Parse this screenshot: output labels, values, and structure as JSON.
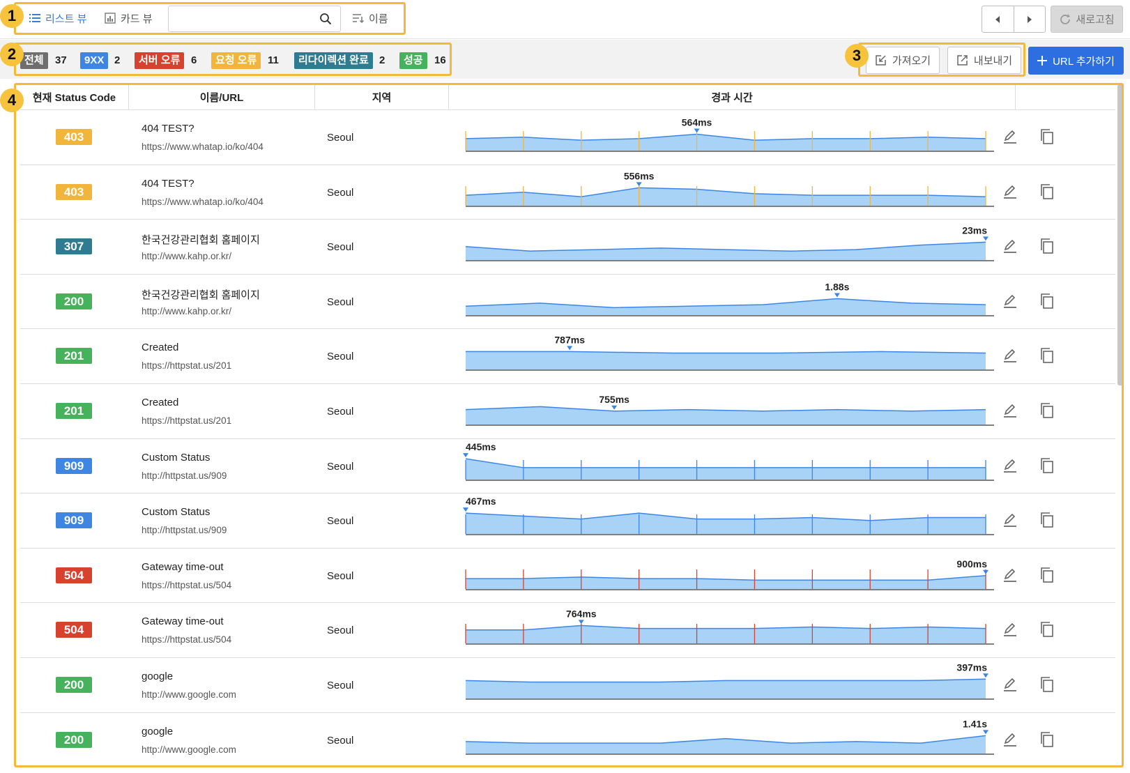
{
  "toolbar": {
    "list_view_label": "리스트 뷰",
    "card_view_label": "카드 뷰",
    "search_value": "",
    "sort_label": "이름",
    "refresh_label": "새로고침"
  },
  "callouts": [
    "1",
    "2",
    "3",
    "4"
  ],
  "filters": [
    {
      "label": "전체",
      "count": "37",
      "color": "#6e6e6e"
    },
    {
      "label": "9XX",
      "count": "2",
      "color": "#3f86e2"
    },
    {
      "label": "서버 오류",
      "count": "6",
      "color": "#d9412f"
    },
    {
      "label": "요청 오류",
      "count": "11",
      "color": "#f1b53b"
    },
    {
      "label": "리다이렉션 완료",
      "count": "2",
      "color": "#2f7c92"
    },
    {
      "label": "성공",
      "count": "16",
      "color": "#46b25b"
    }
  ],
  "actions": {
    "import_label": "가져오기",
    "export_label": "내보내기",
    "add_label": "URL 추가하기"
  },
  "table": {
    "headers": [
      "현재 Status Code",
      "이름/URL",
      "지역",
      "경과 시간",
      ""
    ],
    "rows": [
      {
        "status": "403",
        "status_color": "#f1b53b",
        "name": "404 TEST?",
        "url": "https://www.whatap.io/ko/404",
        "region": "Seoul",
        "peak_label": "564ms",
        "marker_color": "#f1b53b",
        "points": [
          8,
          9,
          7,
          8,
          11,
          7,
          8,
          8,
          9,
          8
        ],
        "peak_index": 4,
        "scale": 13
      },
      {
        "status": "403",
        "status_color": "#f1b53b",
        "name": "404 TEST?",
        "url": "https://www.whatap.io/ko/404",
        "region": "Seoul",
        "peak_label": "556ms",
        "marker_color": "#f1b53b",
        "points": [
          7,
          9,
          6,
          12,
          11,
          8,
          7,
          7,
          7,
          6
        ],
        "peak_index": 3,
        "scale": 13
      },
      {
        "status": "307",
        "status_color": "#2f7c92",
        "name": "한국건강관리협회 홈페이지",
        "url": "http://www.kahp.or.kr/",
        "region": "Seoul",
        "peak_label": "23ms",
        "marker_color": "",
        "points": [
          9,
          6,
          7,
          8,
          7,
          6,
          7,
          10,
          12
        ],
        "peak_index": 8,
        "scale": 13
      },
      {
        "status": "200",
        "status_color": "#46b25b",
        "name": "한국건강관리협회 홈페이지",
        "url": "http://www.kahp.or.kr/",
        "region": "Seoul",
        "peak_label": "1.88s",
        "marker_color": "",
        "points": [
          6,
          8,
          5,
          6,
          7,
          11,
          8,
          7
        ],
        "peak_index": 5,
        "scale": 13
      },
      {
        "status": "201",
        "status_color": "#46b25b",
        "name": "Created",
        "url": "https://httpstat.us/201",
        "region": "Seoul",
        "peak_label": "787ms",
        "marker_color": "",
        "points": [
          12,
          12,
          11,
          11,
          12,
          11
        ],
        "peak_index": 1,
        "scale": 13
      },
      {
        "status": "201",
        "status_color": "#46b25b",
        "name": "Created",
        "url": "https://httpstat.us/201",
        "region": "Seoul",
        "peak_label": "755ms",
        "marker_color": "",
        "points": [
          10,
          12,
          9,
          10,
          9,
          10,
          9,
          10
        ],
        "peak_index": 2,
        "scale": 13
      },
      {
        "status": "909",
        "status_color": "#3f86e2",
        "name": "Custom Status",
        "url": "http://httpstat.us/909",
        "region": "Seoul",
        "peak_label": "445ms",
        "marker_color": "#3f86e2",
        "points": [
          14,
          8,
          8,
          8,
          8,
          8,
          8,
          8,
          8,
          8
        ],
        "peak_index": 0,
        "scale": 15
      },
      {
        "status": "909",
        "status_color": "#3f86e2",
        "name": "Custom Status",
        "url": "http://httpstat.us/909",
        "region": "Seoul",
        "peak_label": "467ms",
        "marker_color": "#3f86e2",
        "points": [
          14,
          12,
          10,
          14,
          10,
          10,
          11,
          9,
          11,
          11
        ],
        "peak_index": 0,
        "scale": 15
      },
      {
        "status": "504",
        "status_color": "#d9412f",
        "name": "Gateway time-out",
        "url": "https://httpstat.us/504",
        "region": "Seoul",
        "peak_label": "900ms",
        "marker_color": "#d9412f",
        "points": [
          7,
          7,
          8,
          7,
          7,
          6,
          6,
          6,
          6,
          9
        ],
        "peak_index": 9,
        "scale": 13
      },
      {
        "status": "504",
        "status_color": "#d9412f",
        "name": "Gateway time-out",
        "url": "https://httpstat.us/504",
        "region": "Seoul",
        "peak_label": "764ms",
        "marker_color": "#d9412f",
        "points": [
          9,
          9,
          12,
          10,
          10,
          10,
          11,
          10,
          11,
          10
        ],
        "peak_index": 2,
        "scale": 13
      },
      {
        "status": "200",
        "status_color": "#46b25b",
        "name": "google",
        "url": "http://www.google.com",
        "region": "Seoul",
        "peak_label": "397ms",
        "marker_color": "",
        "points": [
          12,
          11,
          11,
          11,
          12,
          12,
          12,
          12,
          13
        ],
        "peak_index": 8,
        "scale": 13
      },
      {
        "status": "200",
        "status_color": "#46b25b",
        "name": "google",
        "url": "http://www.google.com",
        "region": "Seoul",
        "peak_label": "1.41s",
        "marker_color": "",
        "points": [
          8,
          7,
          7,
          7,
          10,
          7,
          8,
          7,
          12
        ],
        "peak_index": 8,
        "scale": 13
      }
    ]
  },
  "icons": {
    "list": "list-icon",
    "card": "bar-chart-icon",
    "search": "search-icon",
    "sort": "sort-icon",
    "prev": "caret-left-icon",
    "next": "caret-right-icon",
    "refresh": "refresh-icon",
    "import": "import-icon",
    "export": "export-icon",
    "add": "plus-icon",
    "edit": "pencil-icon",
    "copy": "copy-icon"
  },
  "colors": {
    "highlight": "#f4b93a",
    "accent": "#2d6fe0",
    "chart_fill": "#a9d2f7",
    "chart_line": "#3a86e8"
  }
}
